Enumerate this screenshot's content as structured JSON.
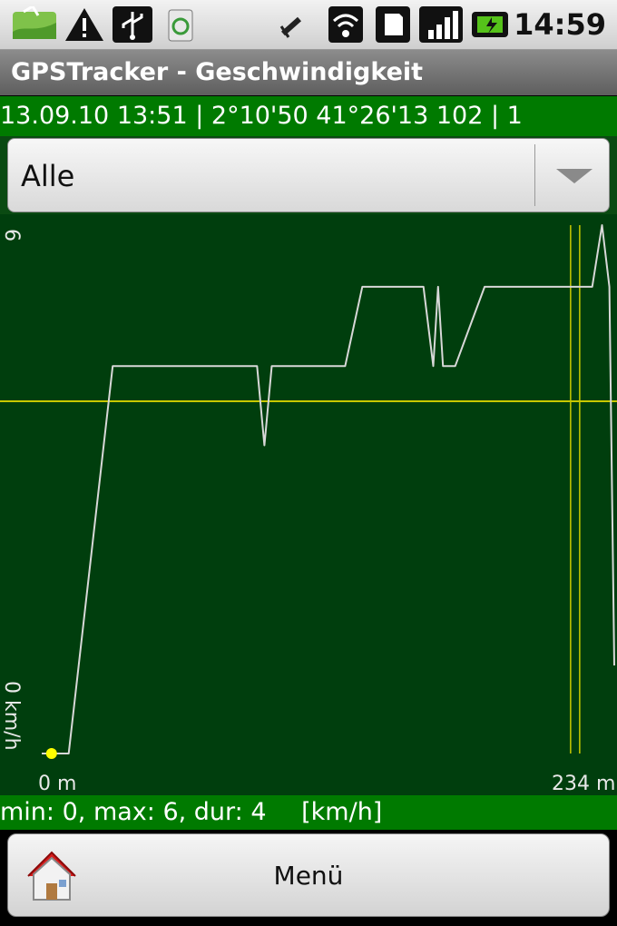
{
  "status_bar": {
    "time": "14:59",
    "icons": [
      "map-notification-icon",
      "warning-icon",
      "usb-icon",
      "recycle-app-icon",
      "satellite-icon",
      "wifi-icon",
      "sd-card-icon",
      "signal-icon",
      "battery-charging-icon"
    ]
  },
  "app": {
    "title": "GPSTracker - Geschwindigkeit"
  },
  "info_line": "13.09.10 13:51 | 2°10'50 41°26'13 102 | 1",
  "filter": {
    "selected": "Alle"
  },
  "chart_data": {
    "type": "line",
    "y_max_label": "6",
    "y_min_label": "0 km/h",
    "x_start_label": "0 m",
    "x_end_label": "234 m",
    "ylim": [
      0,
      6
    ],
    "xlim": [
      0,
      234
    ],
    "average_line": 4,
    "marker_distance": 218,
    "series": [
      {
        "x": [
          0,
          11,
          29,
          88,
          91,
          94,
          124,
          131,
          156,
          160,
          162,
          164,
          169,
          181,
          225,
          229,
          232,
          234
        ],
        "y": [
          0,
          0,
          4.4,
          4.4,
          3.5,
          4.4,
          4.4,
          5.3,
          5.3,
          4.4,
          5.3,
          4.4,
          4.4,
          5.3,
          5.3,
          6,
          5.3,
          1.0
        ]
      }
    ],
    "colors": {
      "line": "#d8d8d8",
      "average": "#c8c800",
      "marker": "#ffff00",
      "background": "#003e0d"
    }
  },
  "stats": {
    "text": "min: 0, max: 6, dur: 4",
    "unit": "[km/h]"
  },
  "bottom_button": {
    "label": "Menü",
    "icon": "home-icon"
  }
}
